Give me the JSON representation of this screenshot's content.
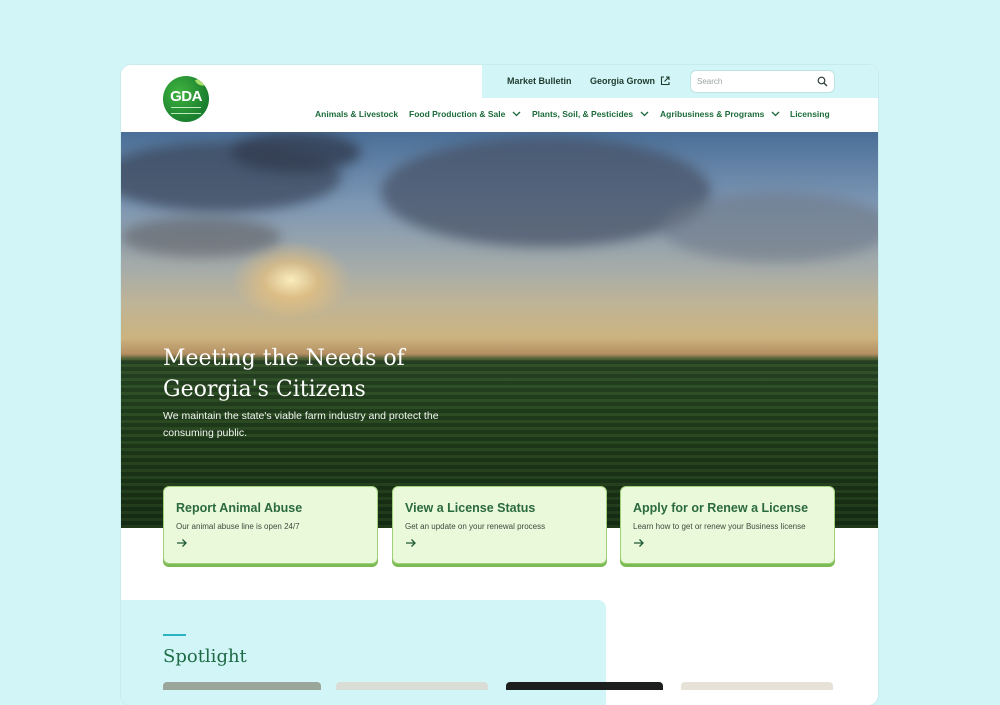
{
  "header": {
    "logo_text": "GDA",
    "utility_links": [
      {
        "label": "Market Bulletin"
      },
      {
        "label": "Georgia Grown"
      }
    ],
    "search": {
      "placeholder": "Search"
    },
    "nav": [
      {
        "label": "Animals & Livestock",
        "dropdown": false
      },
      {
        "label": "Food Production & Sale",
        "dropdown": true
      },
      {
        "label": "Plants, Soil, & Pesticides",
        "dropdown": true
      },
      {
        "label": "Agribusiness & Programs",
        "dropdown": true
      },
      {
        "label": "Licensing",
        "dropdown": false
      }
    ]
  },
  "hero": {
    "title_line1": "Meeting the Needs of",
    "title_line2": "Georgia's Citizens",
    "subtitle": "We maintain the state's viable farm industry and protect the consuming public."
  },
  "cards": [
    {
      "title": "Report Animal Abuse",
      "description": "Our animal abuse line is open 24/7"
    },
    {
      "title": "View a License Status",
      "description": "Get an update on your renewal process"
    },
    {
      "title": "Apply for or Renew a License",
      "description": "Learn how to get or renew your Business license"
    }
  ],
  "spotlight": {
    "title": "Spotlight"
  },
  "colors": {
    "page_bg": "#d2f6f7",
    "nav_green": "#1b6b3a",
    "card_bg": "#eaf9d9",
    "card_border": "#9fd07b",
    "accent_teal": "#2ab3c0",
    "heading_green": "#1e6b46"
  },
  "icons": {
    "search": "search-icon",
    "external": "external-link-icon",
    "dropdown": "chevron-down-icon",
    "card_arrow": "arrow-right-icon"
  }
}
